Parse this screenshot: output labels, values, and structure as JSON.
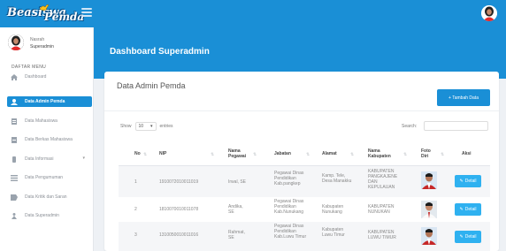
{
  "brand": {
    "word1": "Beasiswa",
    "word2": "Pemda"
  },
  "profile": {
    "name": "Nasrah",
    "role": "Superadmin"
  },
  "menu": {
    "header": "DAFTAR MENU",
    "items": [
      {
        "label": "Dashboard",
        "icon": "home-icon"
      },
      {
        "label": "Data Admin Pemda",
        "icon": "user-icon",
        "active": true
      },
      {
        "label": "Data Mahasiswa",
        "icon": "document-icon"
      },
      {
        "label": "Data Berkas Mahasiswa",
        "icon": "file-icon"
      },
      {
        "label": "Data Informasi",
        "icon": "info-icon",
        "has_caret": true
      },
      {
        "label": "Data Pengumuman",
        "icon": "list-icon"
      },
      {
        "label": "Data Kritik dan Saran",
        "icon": "comment-icon"
      },
      {
        "label": "Data Superadmin",
        "icon": "person-icon"
      }
    ]
  },
  "page": {
    "title": "Dashboard Superadmin"
  },
  "card": {
    "title": "Data Admin Pemda",
    "add_button": "+ Tambah Data"
  },
  "table_controls": {
    "show_label": "Show",
    "show_value": "10",
    "entries_label": "entries",
    "search_label": "Search:"
  },
  "table": {
    "headers": [
      "No",
      "NIP",
      "Nama Pegawai",
      "Jabatan",
      "Alamat",
      "Nama Kabupaten",
      "Foto Diri",
      "Aksi"
    ],
    "rows": [
      {
        "no": "1",
        "nip": "1910072010011019",
        "nama": "Irwal, SE",
        "jabatan": "Pegawai Dinas Pendidikan Kab.pangkep",
        "alamat": "Kamp. Tele, Desa Manakku",
        "kabupaten": "KABUPATEN PANGKAJENE DAN KEPULAUAN",
        "aksi": "Detail"
      },
      {
        "no": "2",
        "nip": "1810070010011078",
        "nama": "Andika, SE",
        "jabatan": "Pegawai Dinas Pendidikan Kab.Nunukang",
        "alamat": "Kabupaten Nunukang",
        "kabupaten": "KABUPATEN NUNUKAN",
        "aksi": "Detail"
      },
      {
        "no": "3",
        "nip": "1310050010011016",
        "nama": "Rahmat, SE",
        "jabatan": "Pegawai Dinas Pendidikan Kab.Luwu Timur",
        "alamat": "Kabupaten Luwu Timur",
        "kabupaten": "KABUPATEN LUWU TIMUR",
        "aksi": "Detail"
      }
    ]
  },
  "colors": {
    "primary": "#1a8fd6",
    "detail": "#2fb1f0",
    "sidebar_bg": "#ffffff",
    "body_bg": "#eef1f5"
  }
}
